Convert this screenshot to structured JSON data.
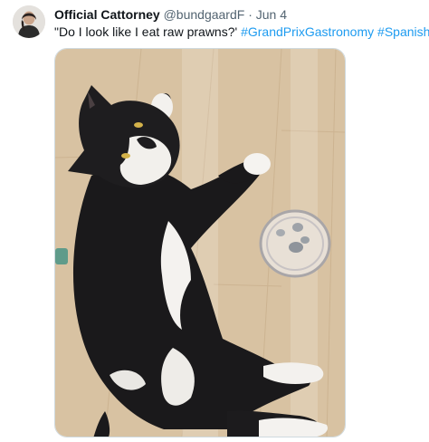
{
  "tweet": {
    "display_name": "Official Cattorney",
    "handle": "@bundgaardF",
    "separator": "·",
    "date": "Jun 4",
    "text_quote": "\"Do I look like I eat raw prawns?'",
    "hashtags": [
      "#GrandPrixGastronomy",
      "#SpanishGP"
    ]
  },
  "media": {
    "description_icon": "cat-photo",
    "subjects": [
      "cat",
      "dish-with-prawns"
    ]
  },
  "colors": {
    "link": "#1d9bf0",
    "text": "#0f1419",
    "muted": "#536471",
    "floor": "#d8c2a2"
  }
}
